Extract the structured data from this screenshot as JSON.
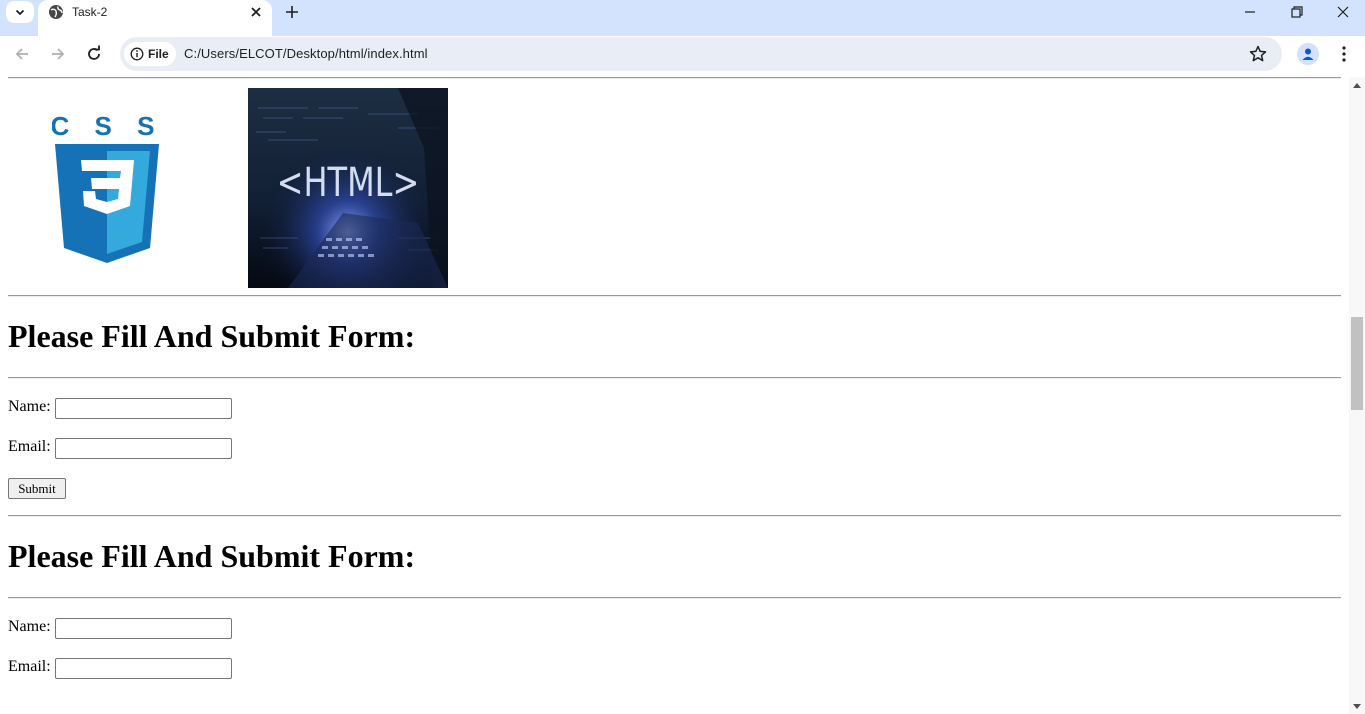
{
  "browser": {
    "tab_title": "Task-2",
    "site_chip_label": "File",
    "url": "C:/Users/ELCOT/Desktop/html/index.html"
  },
  "page": {
    "css_logo_text": "C S S",
    "css_logo_numeral": "3",
    "html_image_text": "<HTML>",
    "forms": [
      {
        "heading": "Please Fill And Submit Form:",
        "name_label": "Name:",
        "name_value": "",
        "email_label": "Email:",
        "email_value": "",
        "submit_label": "Submit"
      },
      {
        "heading": "Please Fill And Submit Form:",
        "name_label": "Name:",
        "name_value": "",
        "email_label": "Email:",
        "email_value": ""
      }
    ]
  },
  "icons": {
    "tab_search": "chevron-down-icon",
    "favicon": "globe-icon",
    "tab_close": "close-icon",
    "new_tab": "plus-icon",
    "back": "arrow-left-icon",
    "forward": "arrow-right-icon",
    "reload": "reload-icon",
    "site_info": "info-icon",
    "bookmark": "star-icon",
    "profile": "person-icon",
    "menu": "kebab-menu-icon"
  },
  "colors": {
    "tabstrip": "#d3e3fd",
    "omnibox": "#e9eef6",
    "css_blue": "#1572b6",
    "css_blue_light": "#33a9dc"
  }
}
